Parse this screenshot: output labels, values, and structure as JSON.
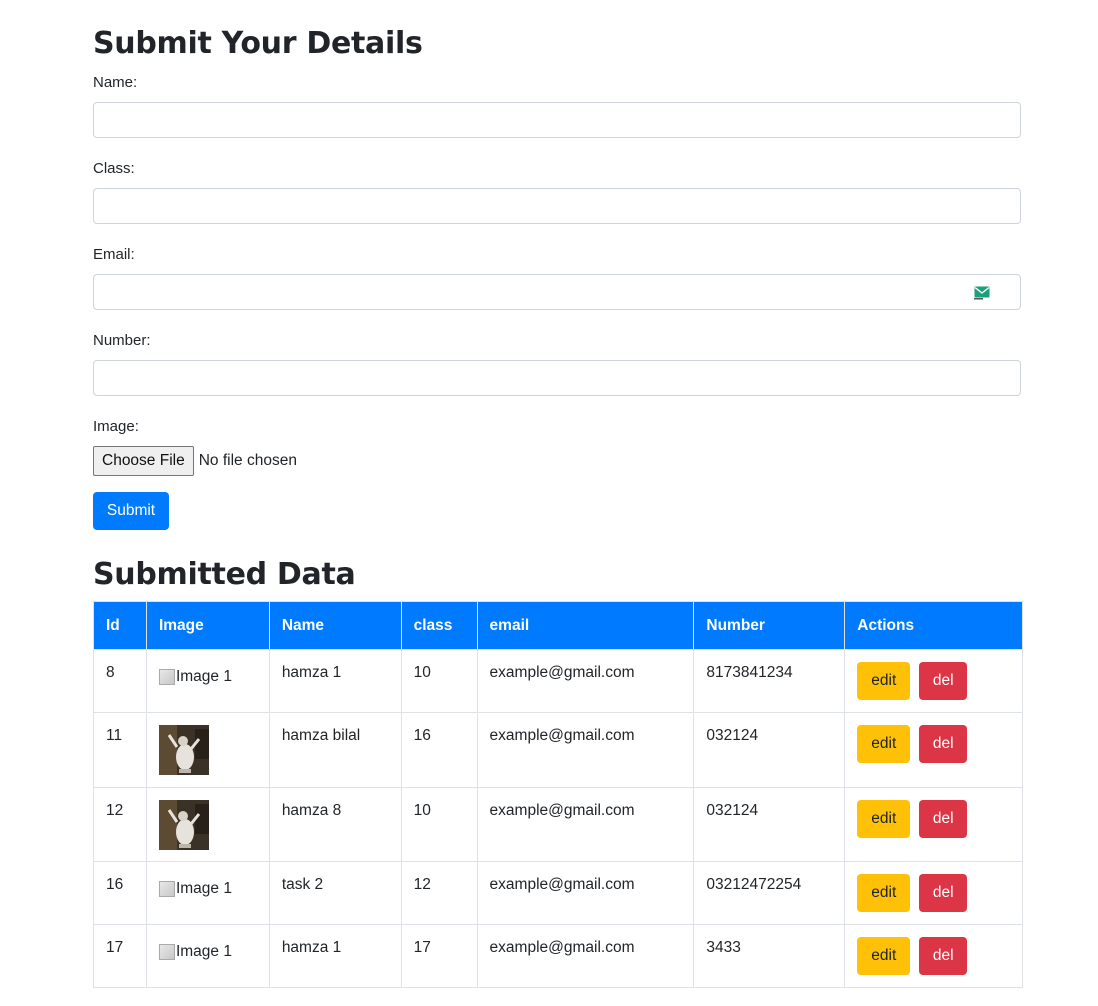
{
  "form": {
    "title": "Submit Your Details",
    "fields": [
      {
        "label": "Name:",
        "value": "",
        "type": "text"
      },
      {
        "label": "Class:",
        "value": "",
        "type": "text"
      },
      {
        "label": "Email:",
        "value": "",
        "type": "email"
      },
      {
        "label": "Number:",
        "value": "",
        "type": "text"
      }
    ],
    "image_label": "Image:",
    "file_button": "Choose File",
    "file_status": "No file chosen",
    "submit_label": "Submit"
  },
  "table": {
    "title": "Submitted Data",
    "headers": [
      "Id",
      "Image",
      "Name",
      "class",
      "email",
      "Number",
      "Actions"
    ],
    "rows": [
      {
        "id": "8",
        "image_alt": "Image 1",
        "image_loaded": false,
        "name": "hamza 1",
        "class": "10",
        "email": "example@gmail.com",
        "number": "8173841234"
      },
      {
        "id": "11",
        "image_alt": "Image 1",
        "image_loaded": true,
        "name": "hamza bilal",
        "class": "16",
        "email": "example@gmail.com",
        "number": "032124"
      },
      {
        "id": "12",
        "image_alt": "Image 1",
        "image_loaded": true,
        "name": "hamza 8",
        "class": "10",
        "email": "example@gmail.com",
        "number": "032124"
      },
      {
        "id": "16",
        "image_alt": "Image 1",
        "image_loaded": false,
        "name": "task 2",
        "class": "12",
        "email": "example@gmail.com",
        "number": "03212472254"
      },
      {
        "id": "17",
        "image_alt": "Image 1",
        "image_loaded": false,
        "name": "hamza 1",
        "class": "17",
        "email": "example@gmail.com",
        "number": "3433"
      }
    ],
    "edit_label": "edit",
    "del_label": "del"
  },
  "colors": {
    "primary": "#007bff",
    "warning": "#ffc107",
    "danger": "#dc3545"
  }
}
